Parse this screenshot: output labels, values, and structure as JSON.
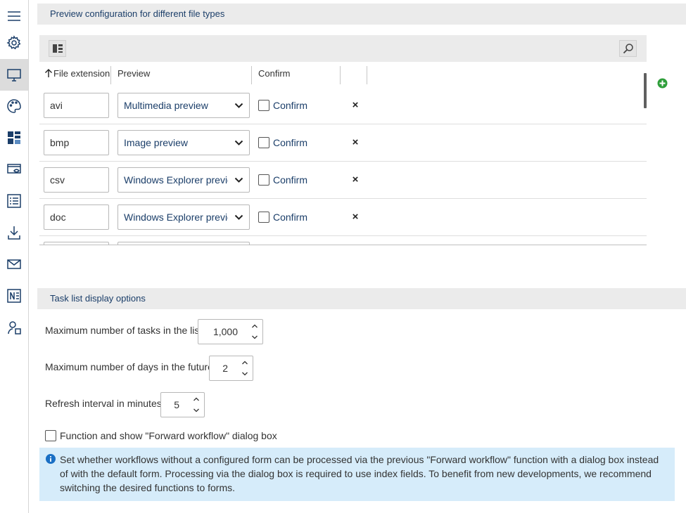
{
  "sidebar": {
    "items": [
      {
        "icon": "menu-icon",
        "active": false
      },
      {
        "icon": "gear-icon",
        "active": false
      },
      {
        "icon": "monitor-icon",
        "active": true
      },
      {
        "icon": "palette-icon",
        "active": false
      },
      {
        "icon": "dashboard-icon",
        "active": false
      },
      {
        "icon": "preview-eye-icon",
        "active": false
      },
      {
        "icon": "list-icon",
        "active": false
      },
      {
        "icon": "download-icon",
        "active": false
      },
      {
        "icon": "mail-icon",
        "active": false
      },
      {
        "icon": "onenote-icon",
        "active": false
      },
      {
        "icon": "agent-icon",
        "active": false
      }
    ]
  },
  "preview_section": {
    "title": "Preview configuration for different file types",
    "columns": [
      "File extension",
      "Preview",
      "Confirm"
    ],
    "sort_icon": "arrow-up-icon",
    "rows": [
      {
        "extension": "avi",
        "preview": "Multimedia preview",
        "confirm_label": "Confirm",
        "confirmed": false
      },
      {
        "extension": "bmp",
        "preview": "Image preview",
        "confirm_label": "Confirm",
        "confirmed": false
      },
      {
        "extension": "csv",
        "preview": "Windows Explorer preview",
        "confirm_label": "Confirm",
        "confirmed": false
      },
      {
        "extension": "doc",
        "preview": "Windows Explorer preview",
        "confirm_label": "Confirm",
        "confirmed": false
      }
    ],
    "delete_symbol": "×"
  },
  "task_section": {
    "title": "Task list display options",
    "max_tasks": {
      "label": "Maximum number of tasks in the list",
      "value": "1,000"
    },
    "max_days": {
      "label": "Maximum number of days in the future",
      "value": "2"
    },
    "refresh": {
      "label": "Refresh interval in minutes",
      "value": "5"
    },
    "forward_checkbox": {
      "label": "Function and show \"Forward workflow\" dialog box",
      "checked": false
    },
    "info_text": "Set whether workflows without a configured form can be processed via the previous \"Forward workflow\" function with a dialog box instead of with the default form. Processing via the dialog box is required to use index fields. To benefit from new developments, we recommend switching the desired functions to forms."
  },
  "colors": {
    "accent": "#1b3e69",
    "header_bg": "#ebebeb",
    "info_bg": "#d6ecfa",
    "add_green": "#2e9e3a"
  }
}
